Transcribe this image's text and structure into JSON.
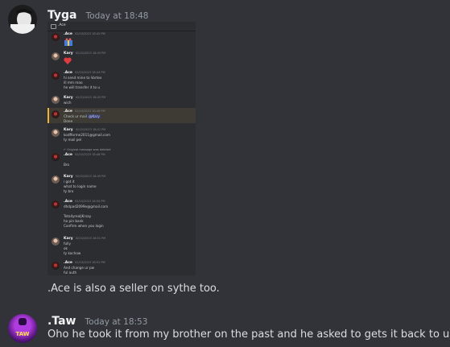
{
  "messages": [
    {
      "author": "Tyga",
      "timestamp": "Today at 18:48",
      "text": ".Ace is also a seller on sythe too."
    },
    {
      "author": ".Taw",
      "timestamp": "Today at 18:53",
      "text": "Oho he took it from my brother on the past and he asked to gets it back to us",
      "avatar_label": "TAW"
    }
  ],
  "embed": {
    "channel": ".Ace",
    "messages": [
      {
        "author": ".Ace",
        "time": "02/10/2023 18:42 PM",
        "lines": []
      },
      {
        "author": "Kary",
        "time": "02/10/2023 18:43 PM",
        "lines": []
      },
      {
        "author": ".Ace",
        "time": "02/10/2023 18:44 PM",
        "lines": [
          "hi send mine to Vortex",
          "ill mm mao",
          "he will transfer it to u"
        ]
      },
      {
        "author": "Kary",
        "time": "02/10/2023 18:45 PM",
        "lines": [
          "wich"
        ]
      },
      {
        "author": ".Ace",
        "time": "02/10/2023 18:46 PM",
        "lines": [
          "Check ur mail"
        ],
        "mention": "@Kary",
        "mention_after": "Done"
      },
      {
        "author": "Kary",
        "time": "02/10/2023 18:47 PM",
        "lines": [
          "kodfforme2011@gmail.com",
          "ty mail pel"
        ]
      },
      {
        "reply": "Original message was deleted",
        "author": ".Ace",
        "time": "02/10/2023 18:48 PM",
        "lines": [
          "Bro"
        ]
      },
      {
        "author": "Kary",
        "time": "02/10/2023 18:49 PM",
        "lines": [
          "i got it",
          "what to login name",
          "ty bro"
        ]
      },
      {
        "author": ".Ace",
        "time": "02/10/2023 18:50 PM",
        "lines": [
          "dhdpad2099e@gmail.com",
          "",
          "TotallyrealjKrsay",
          "ho pin bank",
          "Confirm when you login"
        ]
      },
      {
        "author": "Kary",
        "time": "02/10/2023 18:51 PM",
        "lines": [
          "fully",
          "ok",
          "ty kachow"
        ]
      },
      {
        "author": ".Ace",
        "time": "02/10/2023 18:52 PM",
        "lines": [
          "And change ur pw",
          "ful auth"
        ]
      }
    ]
  },
  "colors": {
    "background": "#313338",
    "embed_bg": "#2b2d31",
    "highlight_border": "#f0b232",
    "heart": "#e33b3b"
  },
  "icons": {
    "heart": "heart-sticker",
    "gift": "gift-sticker"
  }
}
